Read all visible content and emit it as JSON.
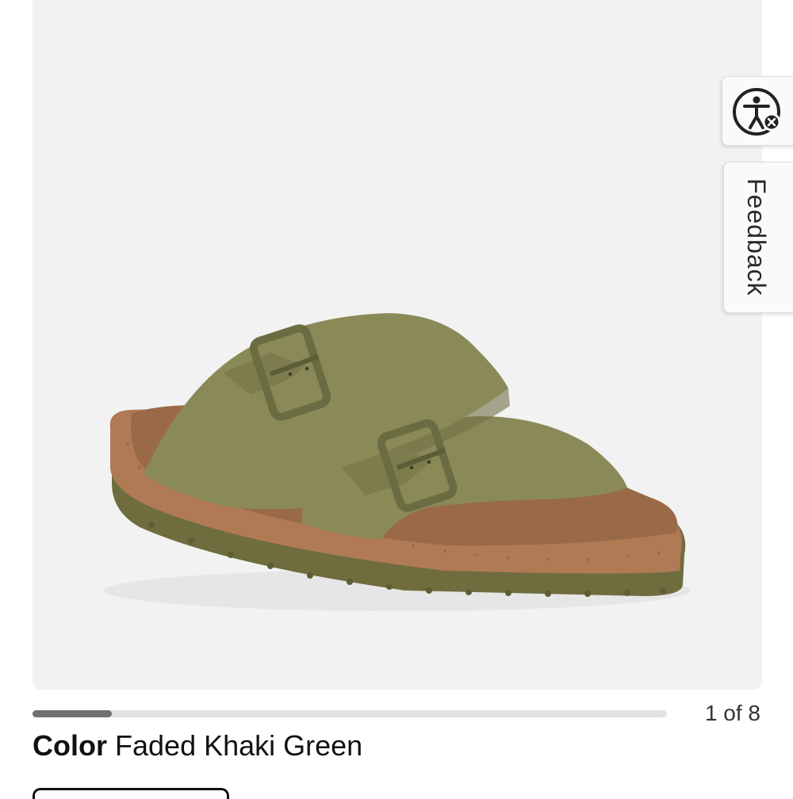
{
  "gallery": {
    "image_alt": "Faded Khaki Green two-strap sandal",
    "counter_text": "1 of 8",
    "progress": 0.125
  },
  "side_tabs": {
    "accessibility_icon": "accessibility-icon",
    "feedback_label": "Feedback"
  },
  "product": {
    "color_label": "Color",
    "color_value": "Faded Khaki Green"
  },
  "colors": {
    "strap": "#8a8a58",
    "footbed": "#9a6a48",
    "cork": "#b07a55",
    "sole": "#6f6d3e",
    "background": "#f2f2f2"
  }
}
